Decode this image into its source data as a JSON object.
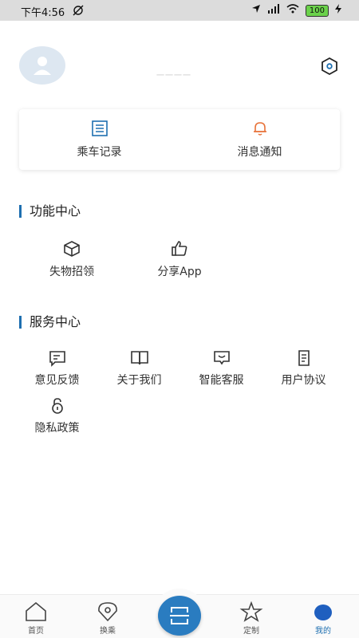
{
  "status_bar": {
    "time": "下午4:56",
    "battery": "100"
  },
  "profile": {
    "username": "一一一一"
  },
  "quick_actions": [
    {
      "label": "乘车记录",
      "icon": "list-icon"
    },
    {
      "label": "消息通知",
      "icon": "bell-icon"
    }
  ],
  "sections": {
    "function": {
      "title": "功能中心",
      "items": [
        {
          "label": "失物招领",
          "icon": "box-icon"
        },
        {
          "label": "分享App",
          "icon": "thumbs-up-icon"
        }
      ]
    },
    "service": {
      "title": "服务中心",
      "items": [
        {
          "label": "意见反馈",
          "icon": "message-icon"
        },
        {
          "label": "关于我们",
          "icon": "book-icon"
        },
        {
          "label": "智能客服",
          "icon": "chat-icon"
        },
        {
          "label": "用户协议",
          "icon": "document-icon"
        },
        {
          "label": "隐私政策",
          "icon": "lock-icon"
        }
      ]
    }
  },
  "tabbar": {
    "items": [
      {
        "label": "首页",
        "icon": "home-icon"
      },
      {
        "label": "换乘",
        "icon": "location-pin-icon"
      },
      {
        "label": "",
        "icon": "scan-icon"
      },
      {
        "label": "定制",
        "icon": "star-icon"
      },
      {
        "label": "我的",
        "icon": "profile-icon"
      }
    ]
  },
  "colors": {
    "accent": "#1e6fb0",
    "bell": "#e8733a",
    "active_dot": "#1f5fbf"
  }
}
